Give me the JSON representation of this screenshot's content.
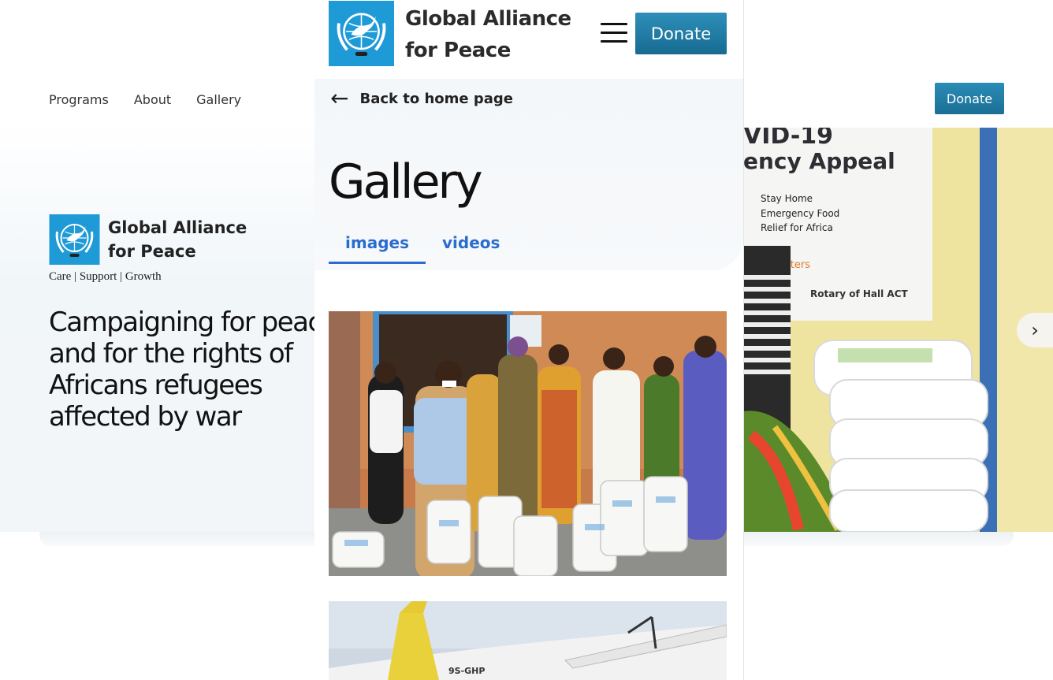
{
  "background_site": {
    "nav": [
      "Programs",
      "About",
      "Gallery"
    ],
    "donate_label": "Donate",
    "brand_name": "Global Alliance for Peace",
    "tagline": "Care | Support | Growth",
    "headline": "Campaigning for peace and for the rights of Africans refugees affected by war",
    "photo_sign": {
      "title_line1": "VID-19",
      "title_line2": "ency Appeal",
      "items": [
        "Stay Home",
        "Emergency Food",
        "Relief for Africa"
      ],
      "supporters": "pporters",
      "sponsor": "Rotary of Hall ACT"
    },
    "next_arrow_icon": "chevron-right-icon"
  },
  "mobile": {
    "brand_name": "Global Alliance for Peace",
    "donate_label": "Donate",
    "menu_icon": "hamburger-icon",
    "back_label": "Back to home page",
    "page_title": "Gallery",
    "tabs": [
      {
        "label": "images",
        "active": true
      },
      {
        "label": "videos",
        "active": false
      }
    ],
    "gallery_images": [
      "food-distribution-photo",
      "airplane-photo"
    ],
    "plane_registration": "9S-GHP"
  },
  "colors": {
    "brand_blue": "#1f7aa3",
    "tab_blue": "#2b6ccf",
    "logo_blue": "#1e9ad6"
  }
}
